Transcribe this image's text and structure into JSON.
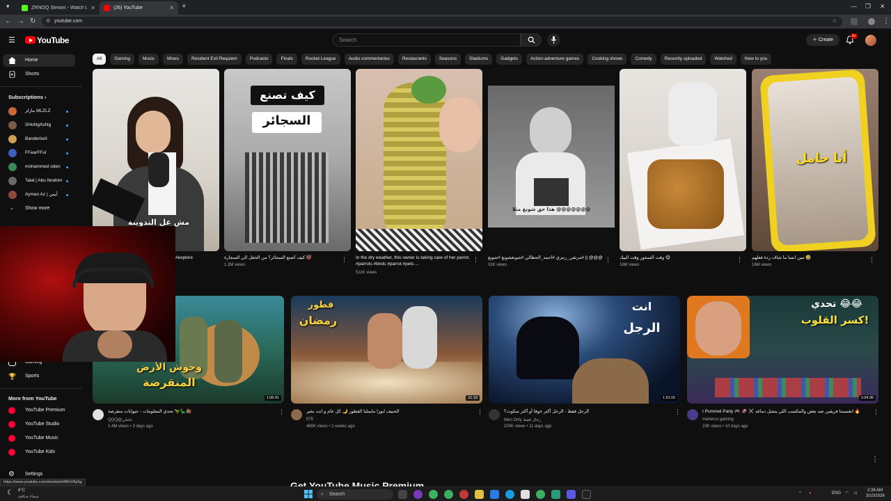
{
  "browser": {
    "tabs": [
      {
        "title": "ZRNOQ Stream - Watch Live o",
        "favicon_color": "#53fc18"
      },
      {
        "title": "(26) YouTube",
        "favicon_color": "#ff0000"
      }
    ],
    "url": "youtube.com",
    "new_tab": "+"
  },
  "header": {
    "logo_text": "YouTube",
    "search_placeholder": "Search",
    "create_label": "Create",
    "notification_count": "9+"
  },
  "chips": [
    "All",
    "Gaming",
    "Music",
    "Mixes",
    "Resident Evil Requiem",
    "Podcasts",
    "Finals",
    "Rocket League",
    "Audio commentaries",
    "Restaurants",
    "Seasons",
    "Stadiums",
    "Gadgets",
    "Action-adventure games",
    "Cooking shows",
    "Comedy",
    "Recently uploaded",
    "Watched",
    "New to you"
  ],
  "sidebar": {
    "home": "Home",
    "shorts": "Shorts",
    "subscriptions_header": "Subscriptions",
    "subscriptions": [
      {
        "name": "مازلز MLZLZ",
        "color": "#c76a3a"
      },
      {
        "name": "SHoNgXoNg",
        "color": "#7a5a48"
      },
      {
        "name": "BanderitaX",
        "color": "#d0a050"
      },
      {
        "name": "FFearFFul",
        "color": "#4060c0"
      },
      {
        "name": "mohammed oden",
        "color": "#3a8a5a"
      },
      {
        "name": "Talal | Abu Ibrahim",
        "color": "#6a6a6a"
      },
      {
        "name": "Ayman Az | أيمن",
        "color": "#8a4a3a"
      }
    ],
    "show_more": "Show more",
    "gaming": "Gaming",
    "sports": "Sports",
    "more_from_header": "More from YouTube",
    "more_from": [
      "YouTube Premium",
      "YouTube Studio",
      "YouTube Music",
      "YouTube Kids"
    ],
    "settings": "Settings"
  },
  "shorts": [
    {
      "title": "#explore",
      "views": "",
      "overlay": "مش عل التدوينة"
    },
    {
      "title": "كيف أصنع السجائر؟ من الحقل الى السجارة 🚭",
      "views": "1.3M views",
      "overlay_1": "كيف تصنع",
      "overlay_2": "السجائر"
    },
    {
      "title": "In the dry weather, this owner is taking care of her parrot. #parrots #birds #parrot #pets ...",
      "views": "511K views"
    },
    {
      "title": "الحلقه هذي عيها هذيه @@@@@@@ || #مرتقي_رمزي #احمد_الحطالي #شونغشونغ #شونغ #sxb ...",
      "views": "31K views",
      "overlay": "هذا حق شونغ مثلا @@@@@@@"
    },
    {
      "title": "وقت السحور وقت البيك 😋",
      "views": "16M views"
    },
    {
      "title": "مين انسا ما شاف ردة فعلهم 🤣",
      "views": "16M views",
      "overlay": "أنا حامل"
    }
  ],
  "videos": [
    {
      "title": "تحدي المعلومات - حيوانات منقرضة 🦖🦕🦣",
      "channel": "QQQ@عاملي",
      "meta": "1.4M views • 3 days ago",
      "duration": "1:06:41",
      "overlay_1": "وحوش الأرض",
      "overlay_2": "المنقرضة",
      "avatar_color": "#e0e0e0"
    },
    {
      "title": "الحنيف ابوزا مايملنا الفطور 🌙 كل عام و انت بخير",
      "channel": "575",
      "meta": "460K views • 2 weeks ago",
      "duration": "21:18",
      "overlay_1": "فطور",
      "overlay_2": "رمضان",
      "avatar_color": "#8a6a4a"
    },
    {
      "title": "الرجل فقط - الرجل أكثر خوفا أو أكثر سكوت؟",
      "channel": "Men Only رجال فقط",
      "meta": "203K views • 11 days ago",
      "duration": "1:10:15",
      "overlay_1": "انت",
      "overlay_2": "الرجل",
      "avatar_color": "#333333"
    },
    {
      "title": "I Pummel Party 🎮 🦑 ⚔️ انقسمنا فريقين ضد بعض والمكسب اللي يتشل دماغه 🔥",
      "channel": "maherco gaming",
      "meta": "23K views • 10 days ago",
      "duration": "1:04:36",
      "overlay_1": "تحدي 😂😂",
      "overlay_2": "كسر القلوب!",
      "avatar_color": "#4a3a8a"
    }
  ],
  "bottom_peek": "Get YouTube Music Premium",
  "status_url": "https://www.youtube.com/shorts/sH48hVr5p5g",
  "taskbar": {
    "weather_temp": "6°C",
    "weather_text": "سماء صافية",
    "search": "Search",
    "lang": "ENG",
    "time": "2:39 AM",
    "date": "3/10/2026"
  }
}
